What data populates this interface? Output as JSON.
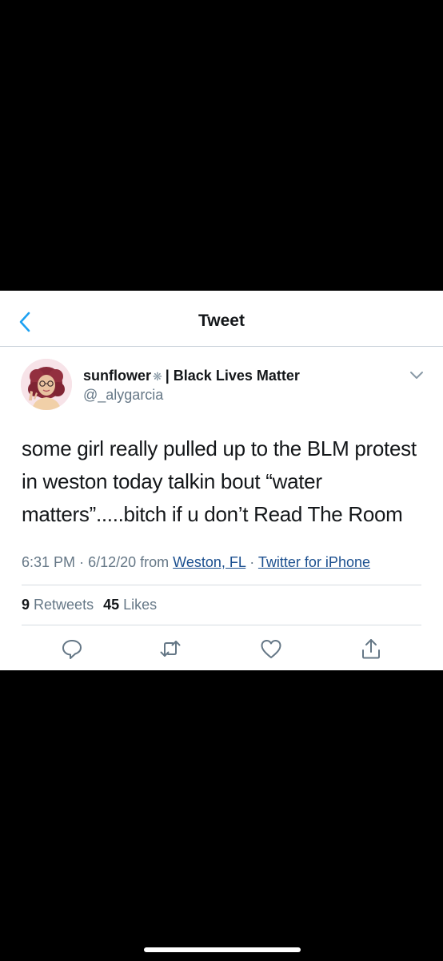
{
  "colors": {
    "background": "#000000",
    "card": "#ffffff",
    "accent": "#1da1f2",
    "text": "#14171a",
    "muted": "#657786",
    "link": "#1b4f8f"
  },
  "navbar": {
    "back_icon": "chevron-left-icon",
    "title": "Tweet"
  },
  "author": {
    "display_name": "sunflower",
    "name_symbol": "❋",
    "name_suffix": "| Black Lives Matter",
    "handle": "@_alygarcia",
    "menu_icon": "chevron-down-icon"
  },
  "tweet": {
    "text": "some girl really pulled up to the BLM protest in weston today talkin bout “water matters”.....bitch if u don’t Read The Room"
  },
  "meta": {
    "time": "6:31 PM",
    "sep1": "·",
    "date": "6/12/20",
    "from_word": "from",
    "location": "Weston, FL",
    "sep2": "·",
    "client": "Twitter for iPhone"
  },
  "stats": {
    "retweets_count": "9",
    "retweets_label": "Retweets",
    "likes_count": "45",
    "likes_label": "Likes"
  },
  "actions": [
    "reply-icon",
    "retweet-icon",
    "like-icon",
    "share-icon"
  ]
}
